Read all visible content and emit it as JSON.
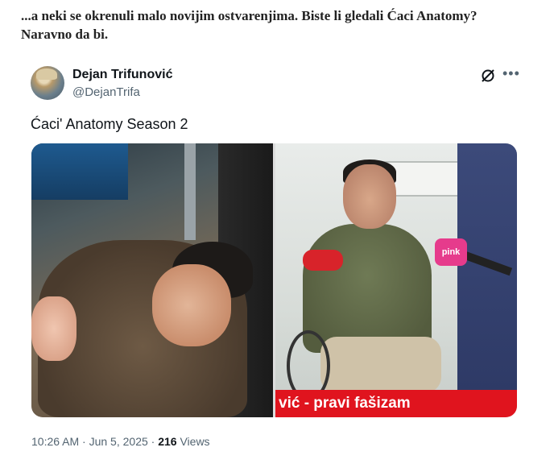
{
  "article": {
    "intro_line1": "...a neki se okrenuli malo novijim ostvarenjima. Biste li gledali Ćaci Anatomy?",
    "intro_line2": "Naravno da bi."
  },
  "tweet": {
    "display_name": "Dejan Trifunović",
    "handle": "@DejanTrifa",
    "text": "Ćaci' Anatomy  Season 2",
    "icons": {
      "grok": "grok-icon",
      "more": "more-options-icon"
    },
    "media": {
      "caption": "vić - pravi fašizam",
      "mic_brand": "pink"
    },
    "timestamp": "10:26 AM · Jun 5, 2025 ·",
    "views_count": "216",
    "views_label": "Views"
  }
}
